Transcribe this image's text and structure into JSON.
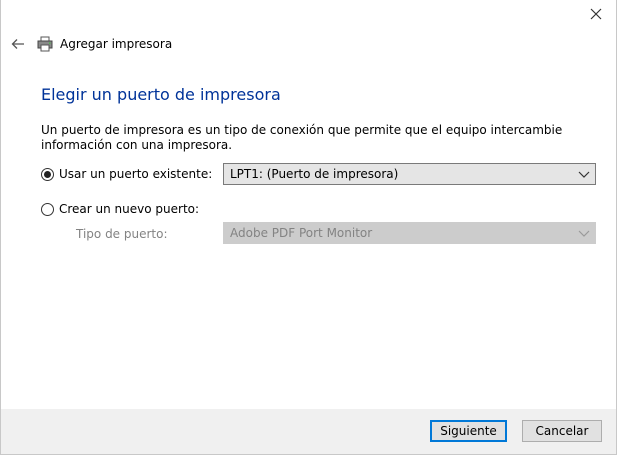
{
  "nav": {
    "title": "Agregar impresora",
    "icons": {
      "back": "arrow-left-icon",
      "printer": "printer-icon",
      "close": "close-icon"
    }
  },
  "main": {
    "heading": "Elegir un puerto de impresora",
    "description": "Un puerto de impresora es un tipo de conexión que permite que el equipo intercambie información con una impresora.",
    "options": [
      {
        "label": "Usar un puerto existente:",
        "checked": true
      },
      {
        "label": "Crear un nuevo puerto:",
        "checked": false
      }
    ],
    "existing_port": {
      "selected": "LPT1: (Puerto de impresora)"
    },
    "new_port": {
      "type_label": "Tipo de puerto:",
      "selected": "Adobe PDF Port Monitor",
      "disabled": true
    }
  },
  "footer": {
    "next_label": "Siguiente",
    "cancel_label": "Cancelar"
  },
  "colors": {
    "heading": "#003399",
    "accent": "#0078d7"
  }
}
